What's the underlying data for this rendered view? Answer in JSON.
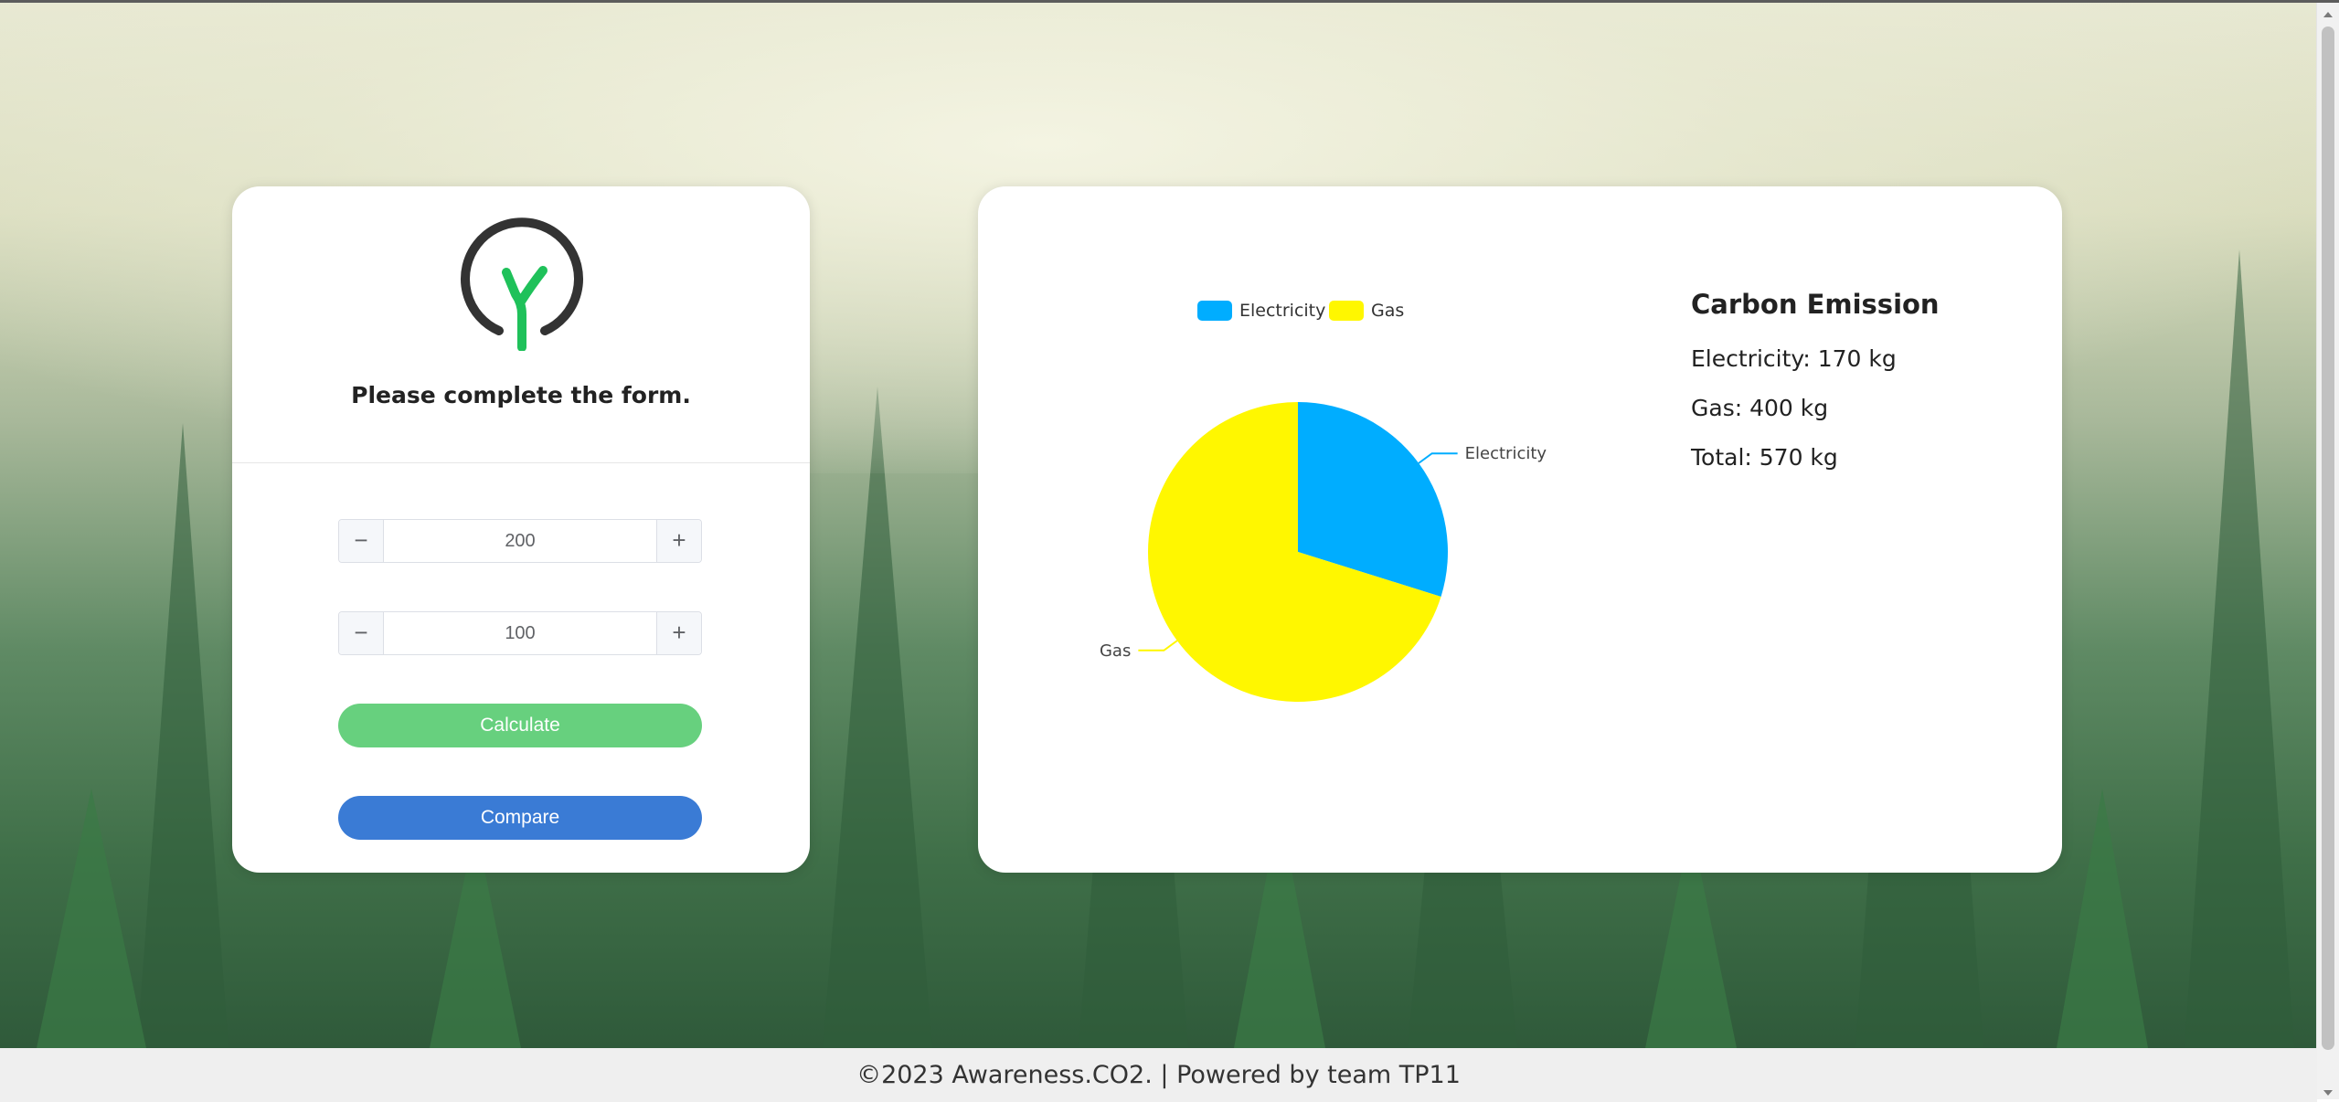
{
  "form": {
    "title": "Please complete the form.",
    "electricity_input": {
      "value": "200",
      "minus": "−",
      "plus": "+"
    },
    "gas_input": {
      "value": "100",
      "minus": "−",
      "plus": "+"
    },
    "calculate_label": "Calculate",
    "compare_label": "Compare"
  },
  "summary": {
    "title": "Carbon Emission",
    "electricity": "Electricity: 170 kg",
    "gas": "Gas: 400 kg",
    "total": "Total: 570 kg"
  },
  "footer": {
    "text": "©2023 Awareness.CO2. | Powered by team TP11"
  },
  "colors": {
    "electricity": "#00adff",
    "gas": "#fff700",
    "calculate": "#67d07e",
    "compare": "#3a7bd5",
    "logo_ring": "#333333",
    "logo_sprout": "#1fc15a"
  },
  "chart_data": {
    "type": "pie",
    "legend_position": "top",
    "categories": [
      "Electricity",
      "Gas"
    ],
    "values": [
      170,
      400
    ],
    "colors": [
      "#00adff",
      "#fff700"
    ],
    "labels": [
      "Electricity",
      "Gas"
    ]
  }
}
